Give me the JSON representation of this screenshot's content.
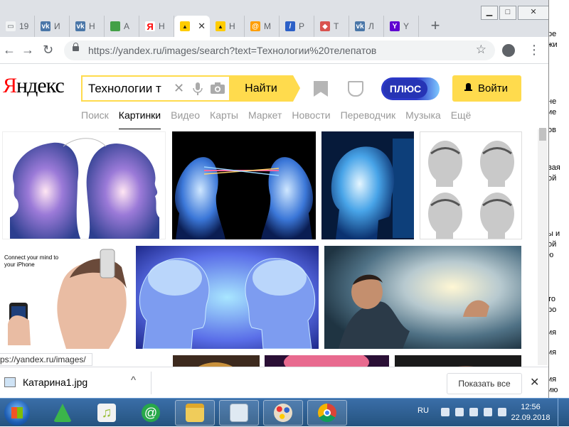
{
  "desktop_right": {
    "fragments": [
      "ре",
      "жи",
      "не",
      "ие",
      "ов",
      "вая",
      "ой",
      "ы и",
      "ой",
      "ю",
      "то",
      "ро",
      "ия",
      "ия",
      "ия",
      "ию"
    ]
  },
  "window_controls": {
    "minimize": "▁",
    "maximize": "□",
    "close": "✕"
  },
  "tabs": [
    {
      "favicon": "doc-icon",
      "label": "19",
      "color": "#f1f3f4",
      "glyph": "▭",
      "active": false
    },
    {
      "favicon": "vk-icon",
      "label": "И",
      "color": "#4a76a8",
      "glyph": "vk",
      "active": false
    },
    {
      "favicon": "vk-icon",
      "label": "Н",
      "color": "#4a76a8",
      "glyph": "vk",
      "active": false
    },
    {
      "favicon": "green-square-icon",
      "label": "A",
      "color": "#43a047",
      "glyph": "",
      "active": false
    },
    {
      "favicon": "yandex-icon",
      "label": "Н",
      "color": "#ffffff",
      "glyph": "Я",
      "active": false
    },
    {
      "favicon": "yandex-images-icon",
      "label": "",
      "color": "#ffcc00",
      "glyph": "▲",
      "active": true
    },
    {
      "favicon": "yandex-images-icon",
      "label": "Н",
      "color": "#ffcc00",
      "glyph": "▲",
      "active": false
    },
    {
      "favicon": "mailru-icon",
      "label": "М",
      "color": "#ff9e00",
      "glyph": "@",
      "active": false
    },
    {
      "favicon": "slash-icon",
      "label": "Р",
      "color": "#2b5fc7",
      "glyph": "/",
      "active": false
    },
    {
      "favicon": "bird-icon",
      "label": "Т",
      "color": "#d9534f",
      "glyph": "◆",
      "active": false
    },
    {
      "favicon": "vk-icon",
      "label": "Л",
      "color": "#4a76a8",
      "glyph": "vk",
      "active": false
    },
    {
      "favicon": "yahoo-icon",
      "label": "Y",
      "color": "#5f01d1",
      "glyph": "Y",
      "active": false
    }
  ],
  "toolbar": {
    "url": "https://yandex.ru/images/search?text=Технологии%20телепатов",
    "back": "←",
    "forward": "→",
    "reload": "↻",
    "star": "☆",
    "menu": "⋮"
  },
  "yandex": {
    "logo_first": "Я",
    "logo_rest": "ндекс",
    "query": "Технологии т",
    "clear": "✕",
    "find": "Найти",
    "plus": "ПЛЮС",
    "login": "Войти",
    "services": [
      "Поиск",
      "Картинки",
      "Видео",
      "Карты",
      "Маркет",
      "Новости",
      "Переводчик",
      "Музыка",
      "Ещё"
    ],
    "active_service": "Картинки"
  },
  "images": {
    "thumb2_caption": "Connect your mind to your iPhone"
  },
  "status_url": "ps://yandex.ru/images/",
  "downloads": {
    "file": "Катарина1.jpg",
    "show_all": "Показать все",
    "close": "✕",
    "chevron": "^"
  },
  "taskbar": {
    "lang": "RU",
    "time": "12:56",
    "date": "22.09.2018"
  }
}
